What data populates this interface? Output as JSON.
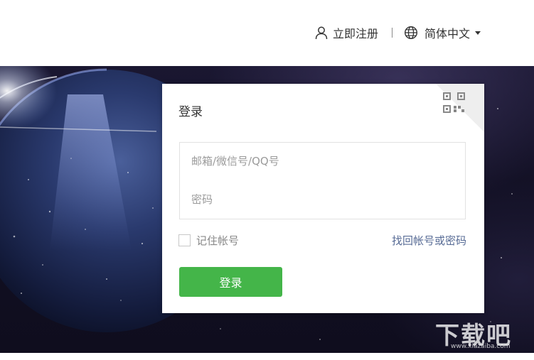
{
  "topbar": {
    "register_label": "立即注册",
    "language_label": "简体中文",
    "icons": {
      "register": "user-icon",
      "language": "globe-icon",
      "dropdown": "caret-down-icon"
    }
  },
  "login": {
    "title": "登录",
    "account_placeholder": "邮箱/微信号/QQ号",
    "password_placeholder": "密码",
    "remember_label": "记住帐号",
    "remember_checked": false,
    "forgot_label": "找回帐号或密码",
    "submit_label": "登录",
    "qr_icon": "qr-code-icon"
  },
  "watermark": {
    "text": "下载吧",
    "url": "www.xiazaiba.com"
  },
  "colors": {
    "accent_green": "#44b549",
    "link_blue": "#576b95",
    "text_dark": "#333333",
    "placeholder_gray": "#9b9b9b"
  }
}
